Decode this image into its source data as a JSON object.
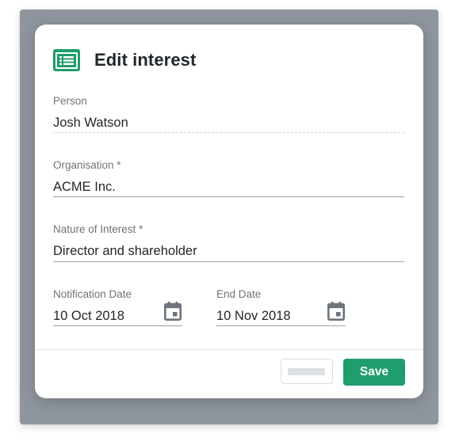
{
  "dialog": {
    "title": "Edit interest",
    "icon": "form-icon",
    "accent_color": "#1f9d6d"
  },
  "fields": {
    "person": {
      "label": "Person",
      "value": "Josh Watson"
    },
    "organisation": {
      "label": "Organisation *",
      "value": "ACME Inc."
    },
    "nature": {
      "label": "Nature of Interest *",
      "value": "Director and shareholder"
    },
    "notification_date": {
      "label": "Notification Date",
      "value": "10 Oct 2018",
      "icon": "calendar-icon"
    },
    "end_date": {
      "label": "End Date",
      "value": "10 Nov 2018",
      "icon": "calendar-icon"
    }
  },
  "footer": {
    "secondary_label": "",
    "save_label": "Save"
  }
}
